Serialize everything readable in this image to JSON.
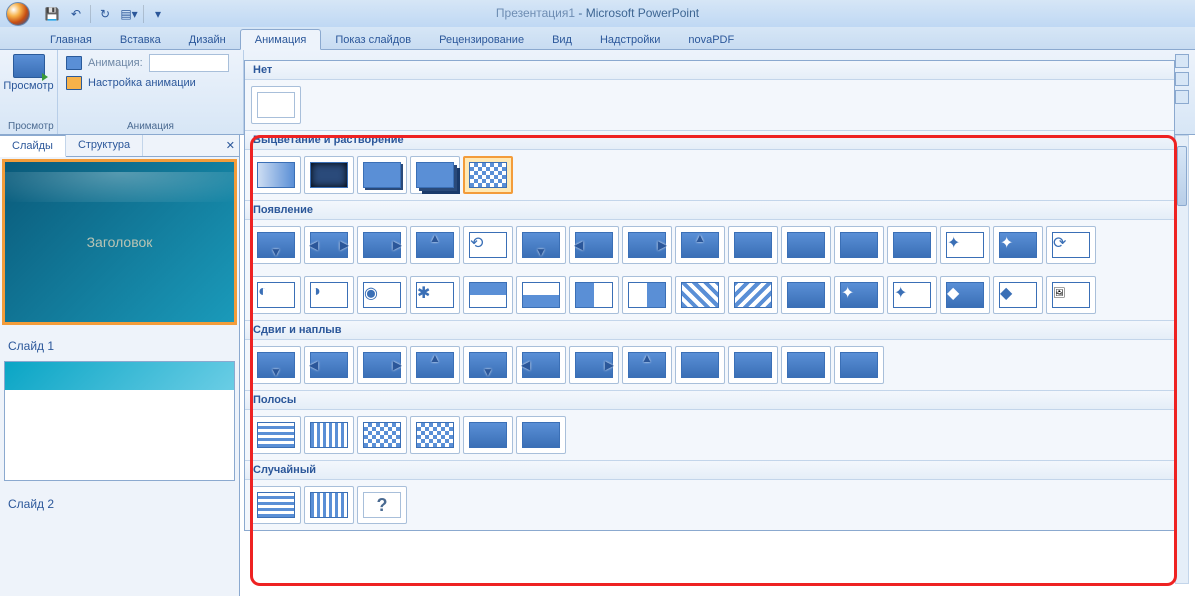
{
  "app": {
    "presentation_name": "Презентация1",
    "app_name": "Microsoft PowerPoint"
  },
  "qat": {
    "save": "💾",
    "undo": "↶",
    "redo": "↻",
    "new": "▦"
  },
  "tabs": {
    "home": "Главная",
    "insert": "Вставка",
    "design": "Дизайн",
    "animation": "Анимация",
    "slideshow": "Показ слайдов",
    "review": "Рецензирование",
    "view": "Вид",
    "addins": "Надстройки",
    "novaPDF": "novaPDF"
  },
  "ribbon": {
    "preview_group": "Просмотр",
    "preview_btn": "Просмотр",
    "animation_group": "Анимация",
    "animation_label": "Анимация:",
    "custom_anim": "Настройка анимации"
  },
  "outline": {
    "slides_tab": "Слайды",
    "structure_tab": "Структура",
    "slide1_title": "Заголовок",
    "slide1_label": "Слайд 1",
    "slide2_label": "Слайд 2"
  },
  "gallery": {
    "none": "Нет",
    "fade": "Выцветание и растворение",
    "appear": "Появление",
    "push": "Сдвиг и наплыв",
    "stripes": "Полосы",
    "random": "Случайный",
    "question": "?"
  },
  "zoom": "6 "
}
